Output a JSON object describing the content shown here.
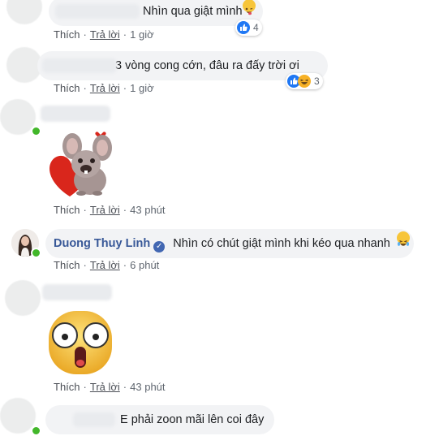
{
  "labels": {
    "like": "Thích",
    "reply": "Trả lời",
    "sep": "·"
  },
  "colors": {
    "link": "#385898",
    "bubble": "#f2f3f5",
    "online": "#42b72a",
    "like": "#2078f4",
    "haha": "#f7b125"
  },
  "comments": [
    {
      "text": "Nhìn qua giật mình",
      "emoji": "tongue-wink-emoji",
      "time": "1 giờ",
      "reactions": {
        "icons": [
          "like-reaction-icon"
        ],
        "count": "4"
      }
    },
    {
      "text": "3 vòng cong cớn, đâu ra đấy trời ơi",
      "time": "1 giờ",
      "reactions": {
        "icons": [
          "like-reaction-icon",
          "haha-reaction-icon"
        ],
        "count": "3"
      }
    },
    {
      "sticker": "mouse-heart-sticker",
      "time": "43 phút"
    },
    {
      "author": "Duong Thuy Linh",
      "verified_icon": "verified-badge-icon",
      "text": "Nhìn có chút giật mình khi kéo qua nhanh",
      "emoji": "laughing-tears-emoji",
      "time": "6 phút"
    },
    {
      "sticker": "shocked-face-sticker",
      "time": "43 phút"
    },
    {
      "text": "E phải zoon mãi lên coi đây"
    }
  ]
}
